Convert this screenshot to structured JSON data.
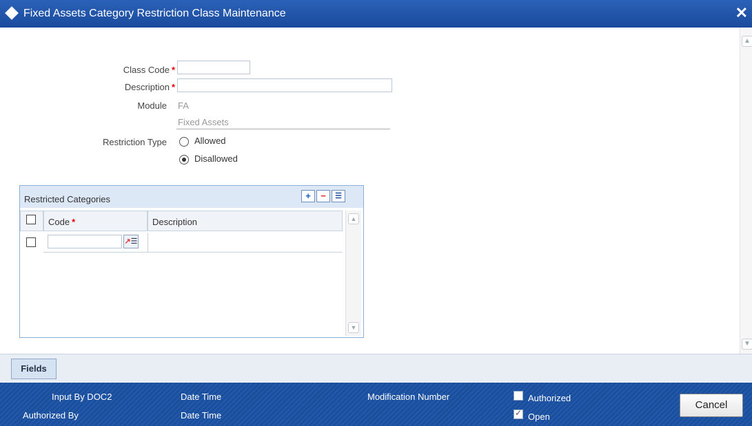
{
  "window": {
    "title": "Fixed Assets Category Restriction Class Maintenance",
    "close_glyph": "✕"
  },
  "form": {
    "class_code": {
      "label": "Class Code",
      "value": ""
    },
    "description": {
      "label": "Description",
      "value": ""
    },
    "module": {
      "label": "Module",
      "code": "FA",
      "name": "Fixed Assets"
    },
    "restriction_type": {
      "label": "Restriction Type",
      "options": [
        "Allowed",
        "Disallowed"
      ],
      "selected": "Disallowed"
    }
  },
  "grid": {
    "title": "Restricted Categories",
    "add_glyph": "+",
    "remove_glyph": "−",
    "view_glyph": "☰",
    "columns": {
      "code": "Code",
      "description": "Description"
    },
    "rows": [
      {
        "code": "",
        "description": ""
      }
    ]
  },
  "fields_tab": {
    "label": "Fields"
  },
  "footer": {
    "input_by": "Input By DOC2",
    "date_time_1": "Date Time",
    "modification_number": "Modification Number",
    "authorized": "Authorized",
    "authorized_by": "Authorized By",
    "date_time_2": "Date Time",
    "open": "Open",
    "authorized_checked": false,
    "open_checked": true,
    "cancel": "Cancel"
  },
  "colors": {
    "title_bar": "#1a4a9c",
    "footer": "#1a4f9e",
    "required": "#e00000"
  },
  "icons": {
    "title": "diamond-icon",
    "close": "close-icon",
    "add": "plus-icon",
    "remove": "minus-icon",
    "view": "list-icon",
    "lov": "lov-icon"
  }
}
